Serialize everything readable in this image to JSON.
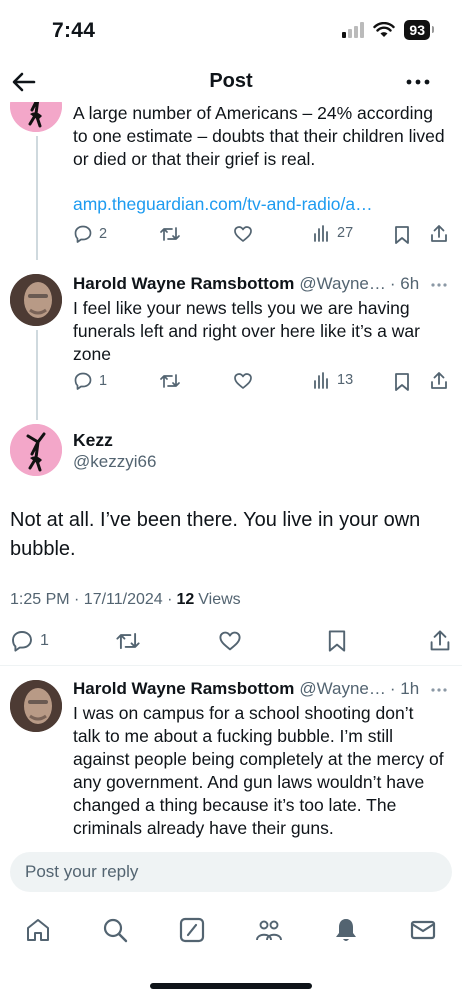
{
  "status_bar": {
    "time": "7:44",
    "battery": "93"
  },
  "header": {
    "title": "Post"
  },
  "thread": [
    {
      "text": "A large number of Americans – 24% according to one estimate – doubts that their children lived or died or that their grief is real.",
      "link": "amp.theguardian.com/tv-and-radio/a…",
      "replies": "2",
      "views": "27"
    },
    {
      "name": "Harold Wayne Ramsbottom",
      "handle": "@Wayne…",
      "time": "· 6h",
      "text": "I feel like your news tells you we are having funerals left and right over here like it’s a war zone",
      "replies": "1",
      "views": "13"
    }
  ],
  "main_post": {
    "name": "Kezz",
    "handle": "@kezzyi66",
    "text": "Not at all. I’ve been there. You live in your own bubble.",
    "timestamp": "1:25 PM · 17/11/2024 ·",
    "views_count": "12",
    "views_label": "Views",
    "replies": "1"
  },
  "reply": {
    "name": "Harold Wayne Ramsbottom",
    "handle": "@Wayne…",
    "time": "· 1h",
    "text": "I was on campus for a school shooting don’t talk to me about a fucking bubble.  I’m still against people being completely at the mercy of any government.  And gun laws wouldn’t have changed a thing because it’s too late.  The criminals already have their guns."
  },
  "reply_bar": {
    "placeholder": "Post your reply"
  },
  "tabs": [
    "home-icon",
    "search-icon",
    "grok-icon",
    "communities-icon",
    "notifications-icon",
    "messages-icon"
  ],
  "colors": {
    "text": "#0f1419",
    "secondary": "#536471",
    "link": "#1d9bf0",
    "divider": "#eff3f4"
  }
}
